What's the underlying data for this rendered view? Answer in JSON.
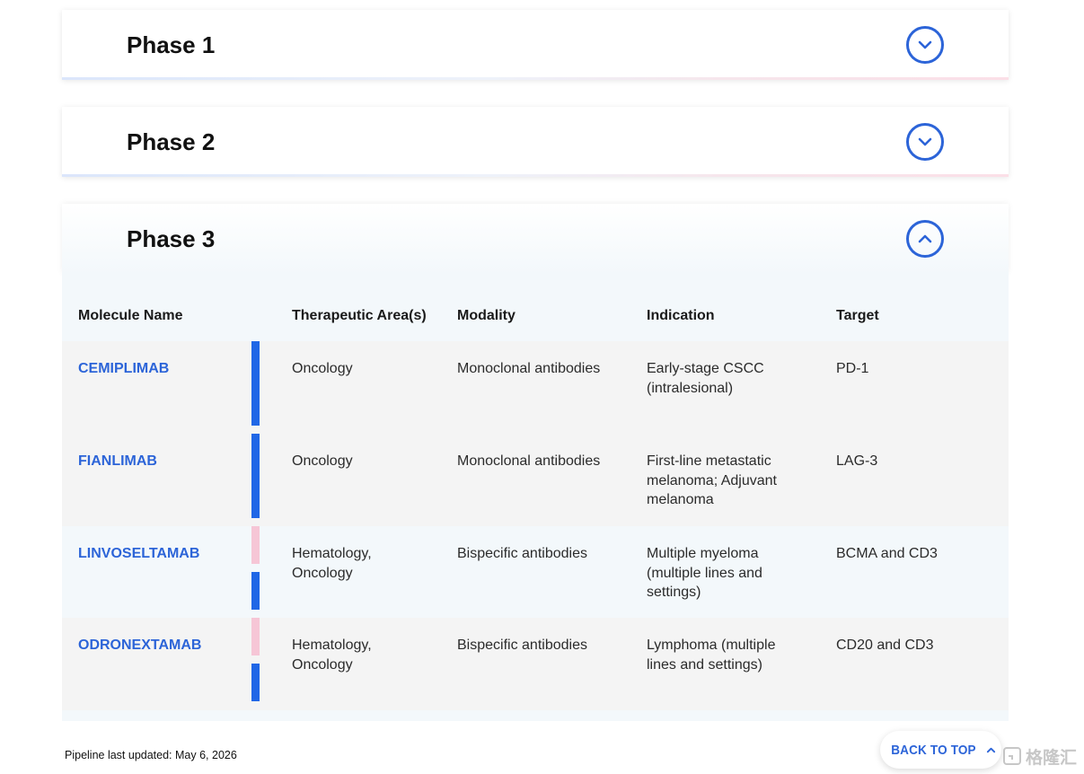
{
  "accordions": [
    {
      "title": "Phase 1",
      "state": "collapsed"
    },
    {
      "title": "Phase 2",
      "state": "collapsed"
    },
    {
      "title": "Phase 3",
      "state": "expanded"
    }
  ],
  "table": {
    "headers": [
      "Molecule Name",
      "Therapeutic Area(s)",
      "Modality",
      "Indication",
      "Target"
    ],
    "rows": [
      {
        "name": "CEMIPLIMAB",
        "therapeutic_area": "Oncology",
        "modality": "Monoclonal antibodies",
        "indication": "Early-stage CSCC (intralesional)",
        "target": "PD-1",
        "bar_colors": [
          "blue"
        ]
      },
      {
        "name": "FIANLIMAB",
        "therapeutic_area": "Oncology",
        "modality": "Monoclonal antibodies",
        "indication": "First-line metastatic melanoma; Adjuvant melanoma",
        "target": "LAG-3",
        "bar_colors": [
          "blue"
        ]
      },
      {
        "name": "LINVOSELTAMAB",
        "therapeutic_area": "Hematology, Oncology",
        "modality": "Bispecific antibodies",
        "indication": "Multiple myeloma (multiple lines and settings)",
        "target": "BCMA and CD3",
        "bar_colors": [
          "pink",
          "blue"
        ]
      },
      {
        "name": "ODRONEXTAMAB",
        "therapeutic_area": "Hematology, Oncology",
        "modality": "Bispecific antibodies",
        "indication": "Lymphoma (multiple lines and settings)",
        "target": "CD20 and CD3",
        "bar_colors": [
          "pink",
          "blue"
        ]
      }
    ]
  },
  "footer": {
    "last_updated": "Pipeline last updated: May 6, 2026"
  },
  "back_to_top": {
    "label": "BACK TO TOP"
  },
  "watermark": {
    "text": "格隆汇"
  },
  "colors": {
    "accent": "#2c64d8",
    "bar_blue": "#2067e6",
    "bar_pink": "#f6c6d6",
    "row_gray": "#f4f4f4",
    "row_light": "#f3f8fb"
  }
}
